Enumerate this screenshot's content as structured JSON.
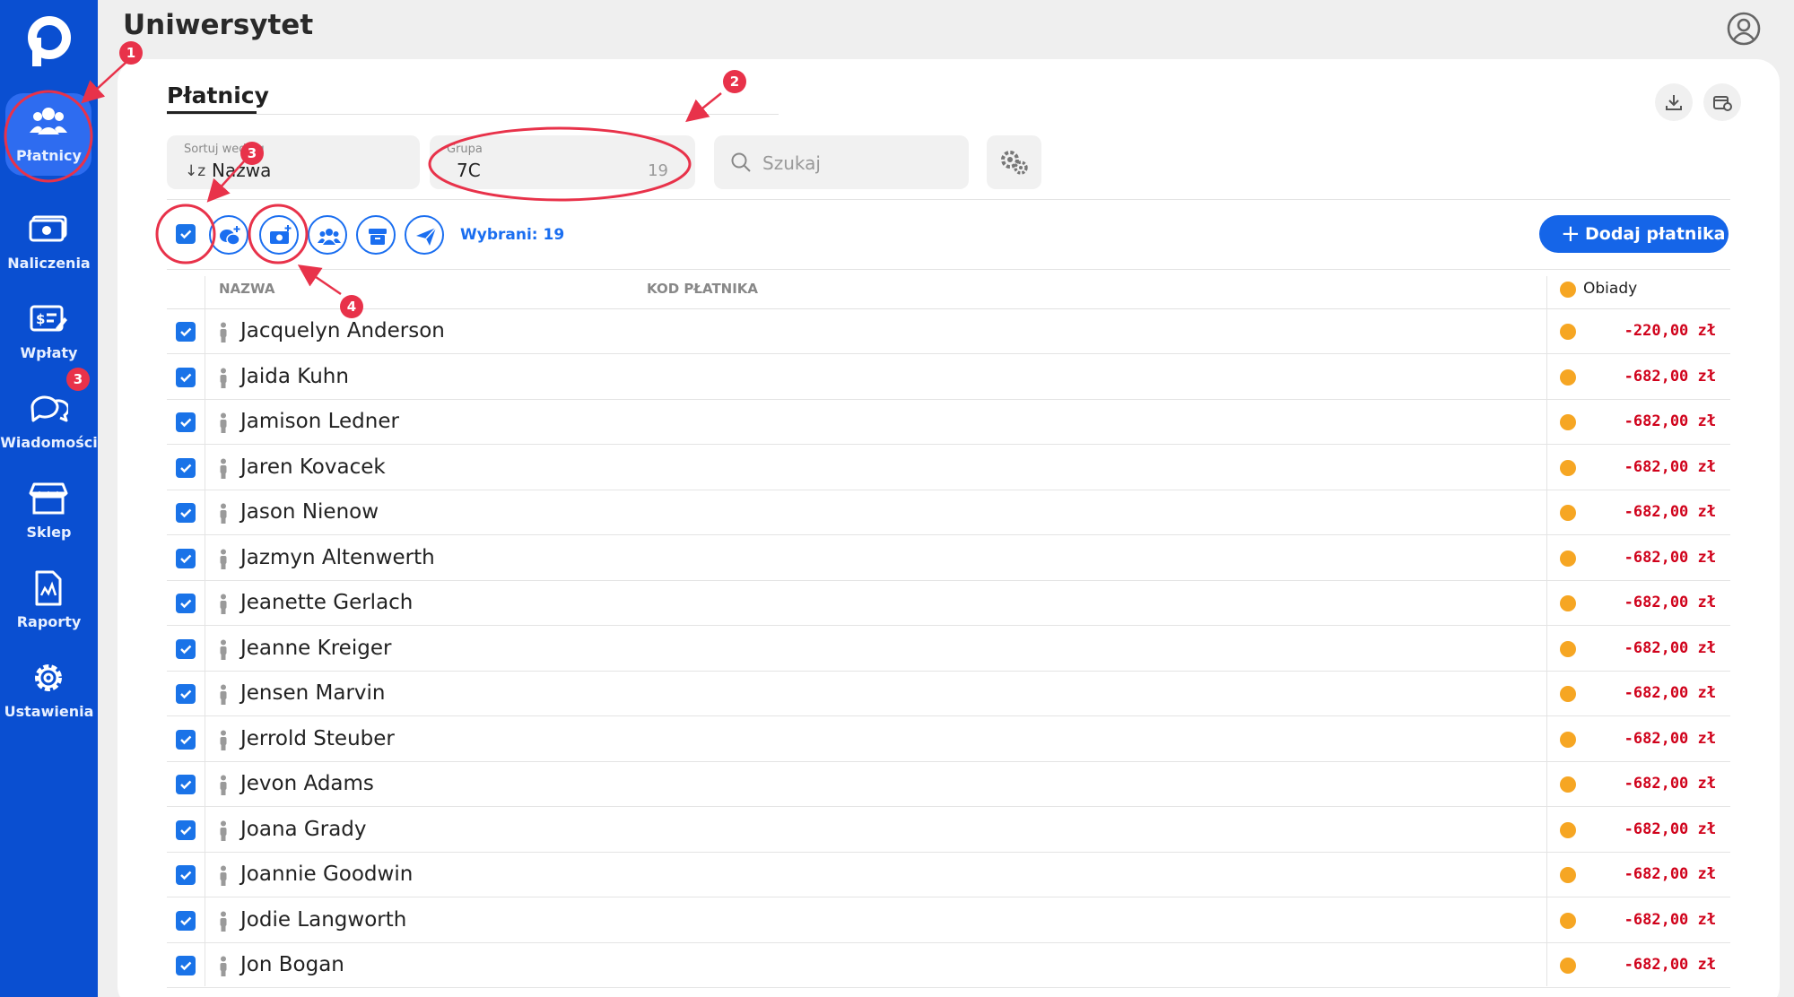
{
  "app": {
    "title": "Uniwersytet"
  },
  "sidebar": {
    "items": [
      {
        "label": "Płatnicy",
        "icon": "users-icon",
        "active": true
      },
      {
        "label": "Naliczenia",
        "icon": "cash-icon"
      },
      {
        "label": "Wpłaty",
        "icon": "payment-icon"
      },
      {
        "label": "Wiadomości",
        "icon": "chat-icon",
        "badge": "3"
      },
      {
        "label": "Sklep",
        "icon": "store-icon"
      },
      {
        "label": "Raporty",
        "icon": "report-icon"
      },
      {
        "label": "Ustawienia",
        "icon": "gear-icon"
      }
    ]
  },
  "page": {
    "title": "Płatnicy"
  },
  "filters": {
    "sort": {
      "label": "Sortuj według",
      "value": "Nazwa"
    },
    "group": {
      "label": "Grupa",
      "value": "7C",
      "count": "19"
    },
    "search": {
      "placeholder": "Szukaj"
    }
  },
  "toolbar": {
    "selected": "Wybrani: 19",
    "add_label": "Dodaj płatnika"
  },
  "table": {
    "columns": {
      "name": "NAZWA",
      "code": "KOD PŁATNIKA",
      "meals": "Obiady"
    },
    "rows": [
      {
        "name": "Jacquelyn Anderson",
        "amount": "-220,00 zł"
      },
      {
        "name": "Jaida Kuhn",
        "amount": "-682,00 zł"
      },
      {
        "name": "Jamison Ledner",
        "amount": "-682,00 zł"
      },
      {
        "name": "Jaren Kovacek",
        "amount": "-682,00 zł"
      },
      {
        "name": "Jason Nienow",
        "amount": "-682,00 zł"
      },
      {
        "name": "Jazmyn Altenwerth",
        "amount": "-682,00 zł"
      },
      {
        "name": "Jeanette Gerlach",
        "amount": "-682,00 zł"
      },
      {
        "name": "Jeanne Kreiger",
        "amount": "-682,00 zł"
      },
      {
        "name": "Jensen Marvin",
        "amount": "-682,00 zł"
      },
      {
        "name": "Jerrold Steuber",
        "amount": "-682,00 zł"
      },
      {
        "name": "Jevon Adams",
        "amount": "-682,00 zł"
      },
      {
        "name": "Joana Grady",
        "amount": "-682,00 zł"
      },
      {
        "name": "Joannie Goodwin",
        "amount": "-682,00 zł"
      },
      {
        "name": "Jodie Langworth",
        "amount": "-682,00 zł"
      },
      {
        "name": "Jon Bogan",
        "amount": "-682,00 zł"
      }
    ]
  },
  "annotations": [
    "1",
    "2",
    "3",
    "4"
  ],
  "colors": {
    "brand": "#0a4fd1",
    "accent": "#1565e8",
    "negative": "#d0021b",
    "meal_dot": "#f6a623",
    "annotation": "#e8324a"
  }
}
